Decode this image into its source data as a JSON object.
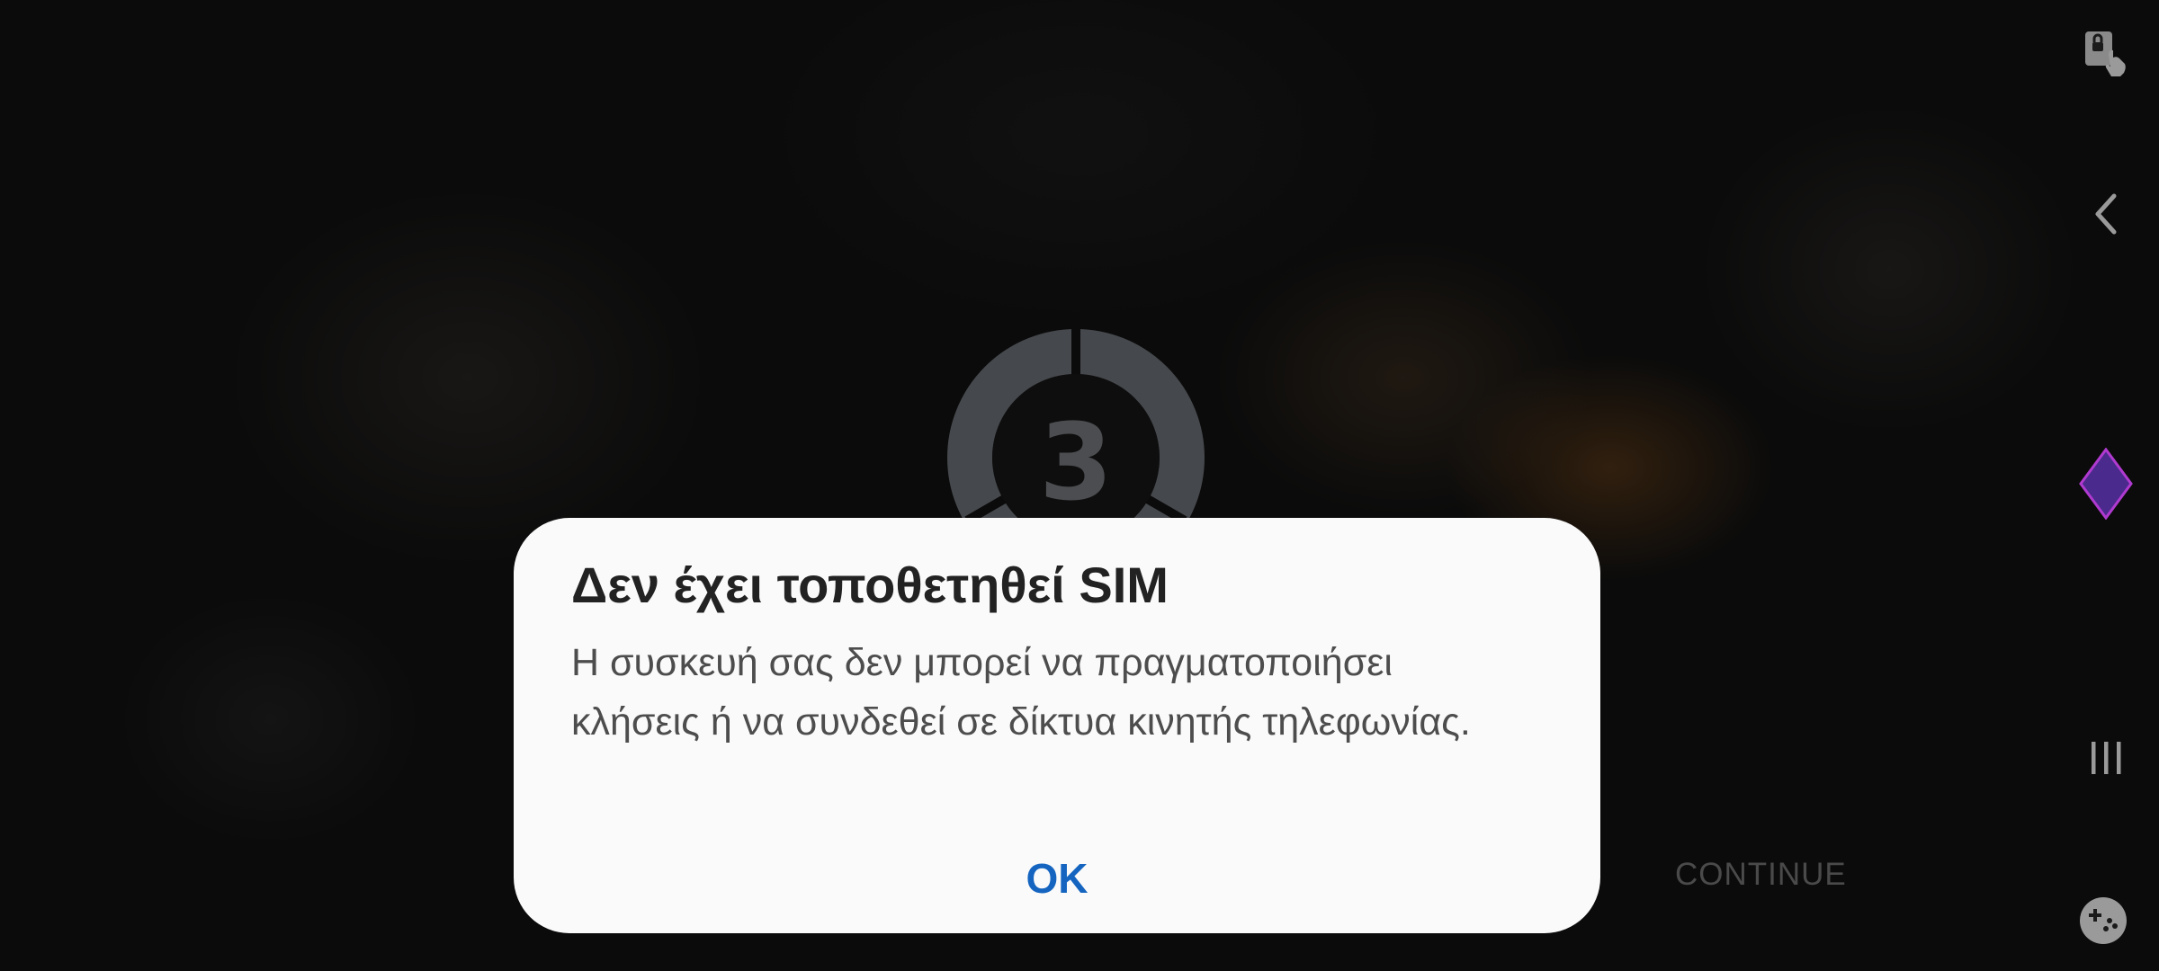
{
  "game": {
    "countdown_number": "3",
    "continue_label": "CONTINUE"
  },
  "side_bar": {
    "icons": [
      "touch-lock-icon",
      "back-chevron-icon",
      "game-booster-diamond-icon",
      "recent-apps-icon",
      "gamepad-icon"
    ],
    "diamond_color": "#4a2a8c",
    "diamond_border_color": "#b03ad0"
  },
  "dialog": {
    "title": "Δεν έχει τοποθετηθεί SIM",
    "message": "Η συσκευή σας δεν μπορεί να πραγματοποιήσει κλήσεις ή να συνδεθεί σε δίκτυα κινητής τηλεφωνίας.",
    "ok_label": "OK",
    "accent_color": "#1565c0"
  }
}
